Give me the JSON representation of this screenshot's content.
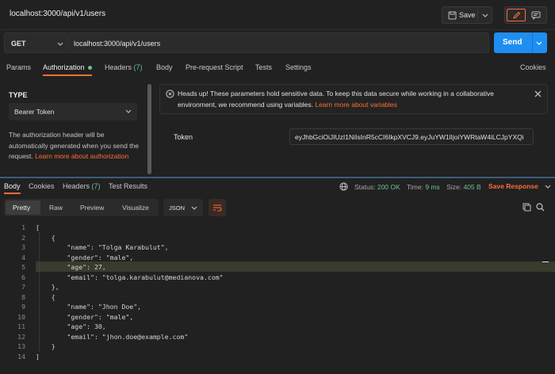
{
  "window": {
    "title": "localhost:3000/api/v1/users"
  },
  "toolbar": {
    "save_label": "Save"
  },
  "request": {
    "method": "GET",
    "url": "localhost:3000/api/v1/users",
    "send_label": "Send"
  },
  "req_tabs": {
    "params": "Params",
    "authorization": "Authorization",
    "headers": "Headers",
    "headers_count": "(7)",
    "body": "Body",
    "prerequest": "Pre-request Script",
    "tests": "Tests",
    "settings": "Settings",
    "cookies": "Cookies"
  },
  "auth": {
    "type_heading": "TYPE",
    "type_value": "Bearer Token",
    "description": "The authorization header will be automatically generated when you send the request.",
    "learn_more": "Learn more about authorization",
    "alert_text": "Heads up! These parameters hold sensitive data. To keep this data secure while working in a collaborative environment, we recommend using variables.",
    "alert_link": "Learn more about variables",
    "token_label": "Token",
    "token_value": "eyJhbGciOiJIUzI1NiIsInR5cCI6IkpXVCJ9.eyJuYW1lIjoiYWRtaW4iLCJpYXQi"
  },
  "resp_tabs": {
    "body": "Body",
    "cookies": "Cookies",
    "headers": "Headers",
    "headers_count": "(7)",
    "test_results": "Test Results"
  },
  "status": {
    "status_label": "Status:",
    "status_value": "200 OK",
    "time_label": "Time:",
    "time_value": "9 ms",
    "size_label": "Size:",
    "size_value": "405 B",
    "save_response": "Save Response"
  },
  "view": {
    "pretty": "Pretty",
    "raw": "Raw",
    "preview": "Preview",
    "visualize": "Visualize",
    "format": "JSON"
  },
  "code": {
    "lines": [
      "1",
      "2",
      "3",
      "4",
      "5",
      "6",
      "7",
      "8",
      "9",
      "10",
      "11",
      "12",
      "13",
      "14"
    ],
    "text": [
      "[",
      "    {",
      "        \"name\": \"Tolga Karabulut\",",
      "        \"gender\": \"male\",",
      "        \"age\": 27,",
      "        \"email\": \"tolga.karabulut@medianova.com\"",
      "    },",
      "    {",
      "        \"name\": \"Jhon Doe\",",
      "        \"gender\": \"male\",",
      "        \"age\": 30,",
      "        \"email\": \"jhon.doe@example.com\"",
      "    }",
      "]"
    ]
  },
  "colors": {
    "accent": "#ff6c37",
    "primary": "#1f8ef1",
    "success": "#6ac28e"
  },
  "icons": [
    "save-icon",
    "chevron-down-icon",
    "pencil-icon",
    "comment-icon",
    "info-icon",
    "close-icon",
    "globe-icon",
    "copy-icon",
    "search-icon",
    "wrap-lines-icon"
  ]
}
